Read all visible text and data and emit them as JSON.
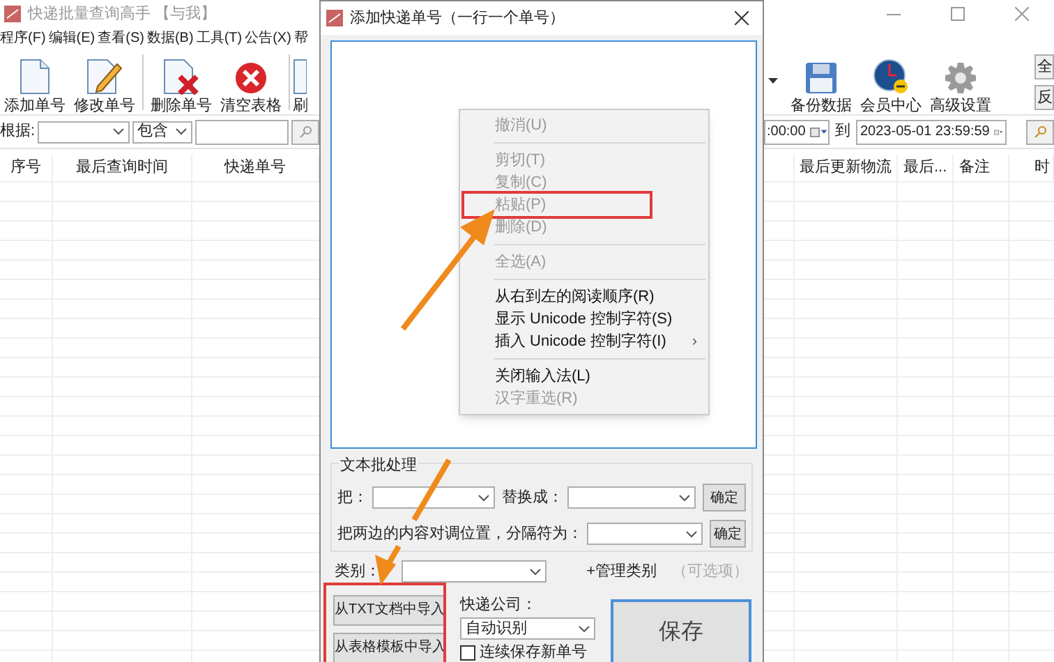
{
  "main_window": {
    "title": "快递批量查询高手 【与我】",
    "menu": [
      "程序(F)",
      "编辑(E)",
      "查看(S)",
      "数据(B)",
      "工具(T)",
      "公告(X)",
      "帮"
    ],
    "toolbar_left": [
      {
        "label": "添加单号",
        "kind": "doc"
      },
      {
        "label": "修改单号",
        "kind": "edit"
      },
      {
        "label": "删除单号",
        "kind": "delete"
      },
      {
        "label": "清空表格",
        "kind": "clear"
      },
      {
        "label": "刷",
        "kind": "refresh"
      }
    ],
    "toolbar_right": [
      {
        "label": "备份数据",
        "kind": "floppy"
      },
      {
        "label": "会员中心",
        "kind": "clock"
      },
      {
        "label": "高级设置",
        "kind": "gear"
      }
    ],
    "side_buttons": [
      "全",
      "反"
    ],
    "filter": {
      "by_label": "根据:",
      "match": "包含",
      "date_from": ":00:00",
      "to_label": "到",
      "date_to": "2023-05-01 23:59:59"
    },
    "table_left_columns": [
      "序号",
      "最后查询时间",
      "快递单号"
    ],
    "table_right_columns": [
      "最后更新物流",
      "最后...",
      "备注",
      "时"
    ]
  },
  "dialog": {
    "title": "添加快递单号（一行一个单号）",
    "context_menu": [
      {
        "kind": "item",
        "label": "撤消(U)",
        "disabled": true,
        "highlighted": false
      },
      {
        "kind": "separator"
      },
      {
        "kind": "item",
        "label": "剪切(T)",
        "disabled": true,
        "highlighted": false
      },
      {
        "kind": "item",
        "label": "复制(C)",
        "disabled": true,
        "highlighted": false
      },
      {
        "kind": "item",
        "label": "粘贴(P)",
        "disabled": true,
        "highlighted": true
      },
      {
        "kind": "item",
        "label": "删除(D)",
        "disabled": true,
        "highlighted": false
      },
      {
        "kind": "separator"
      },
      {
        "kind": "item",
        "label": "全选(A)",
        "disabled": true,
        "highlighted": false
      },
      {
        "kind": "separator"
      },
      {
        "kind": "item",
        "label": "从右到左的阅读顺序(R)",
        "disabled": false,
        "highlighted": false
      },
      {
        "kind": "item",
        "label": "显示 Unicode 控制字符(S)",
        "disabled": false,
        "highlighted": false
      },
      {
        "kind": "item",
        "label": "插入 Unicode 控制字符(I)",
        "disabled": false,
        "highlighted": false,
        "arrow": "›"
      },
      {
        "kind": "separator"
      },
      {
        "kind": "item",
        "label": "关闭输入法(L)",
        "disabled": false,
        "highlighted": false
      },
      {
        "kind": "item",
        "label": "汉字重选(R)",
        "disabled": true,
        "highlighted": false
      }
    ],
    "batch": {
      "title": "文本批处理",
      "replace_label": "把：",
      "with_label": "替换成：",
      "confirm": "确定",
      "swap_label": "把两边的内容对调位置，分隔符为：",
      "confirm2": "确定"
    },
    "category_label": "类别：",
    "manage": "+管理类别",
    "optional": "（可选项）",
    "import_txt": "从TXT文档中导入",
    "import_table": "从表格模板中导入",
    "imports_highlighted": true,
    "courier_label": "快递公司：",
    "courier_value": "自动识别",
    "continuous": {
      "label": "连续保存新单号",
      "checked": false
    },
    "save": "保存"
  }
}
